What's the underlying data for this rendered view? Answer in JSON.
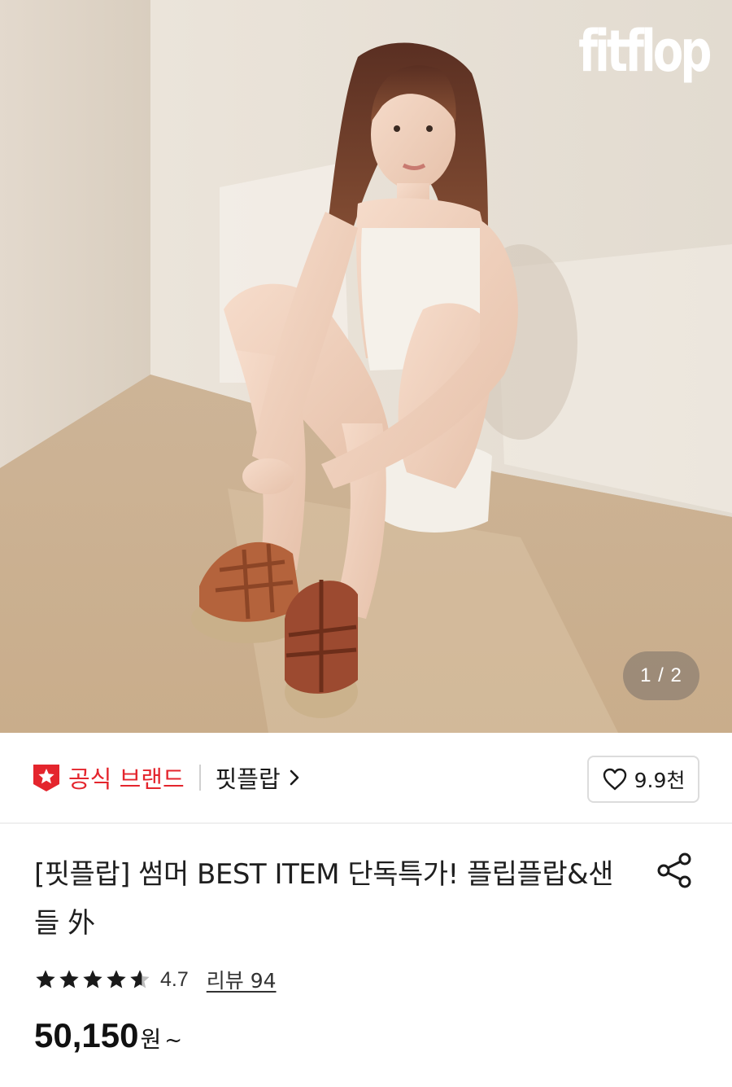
{
  "hero": {
    "brand_logo_text": "fitflop",
    "page_indicator": "1 / 2",
    "image_subject": "model-sitting-with-sandals"
  },
  "brand_bar": {
    "official_label": "공식 브랜드",
    "store_name": "핏플랍",
    "like_count": "9.9천",
    "accent_color": "#e4252d"
  },
  "product": {
    "title": "[핏플랍] 썸머 BEST ITEM 단독특가! 플립플랍&샌들 外",
    "rating": "4.7",
    "review_link": "리뷰 94",
    "price": "50,150",
    "price_unit": "원",
    "price_suffix": "~"
  },
  "icons": {
    "official": "official-brand-star-icon",
    "store": "chevron-right-icon",
    "like": "heart-outline-icon",
    "share": "share-icon",
    "rating": "star-icon"
  }
}
